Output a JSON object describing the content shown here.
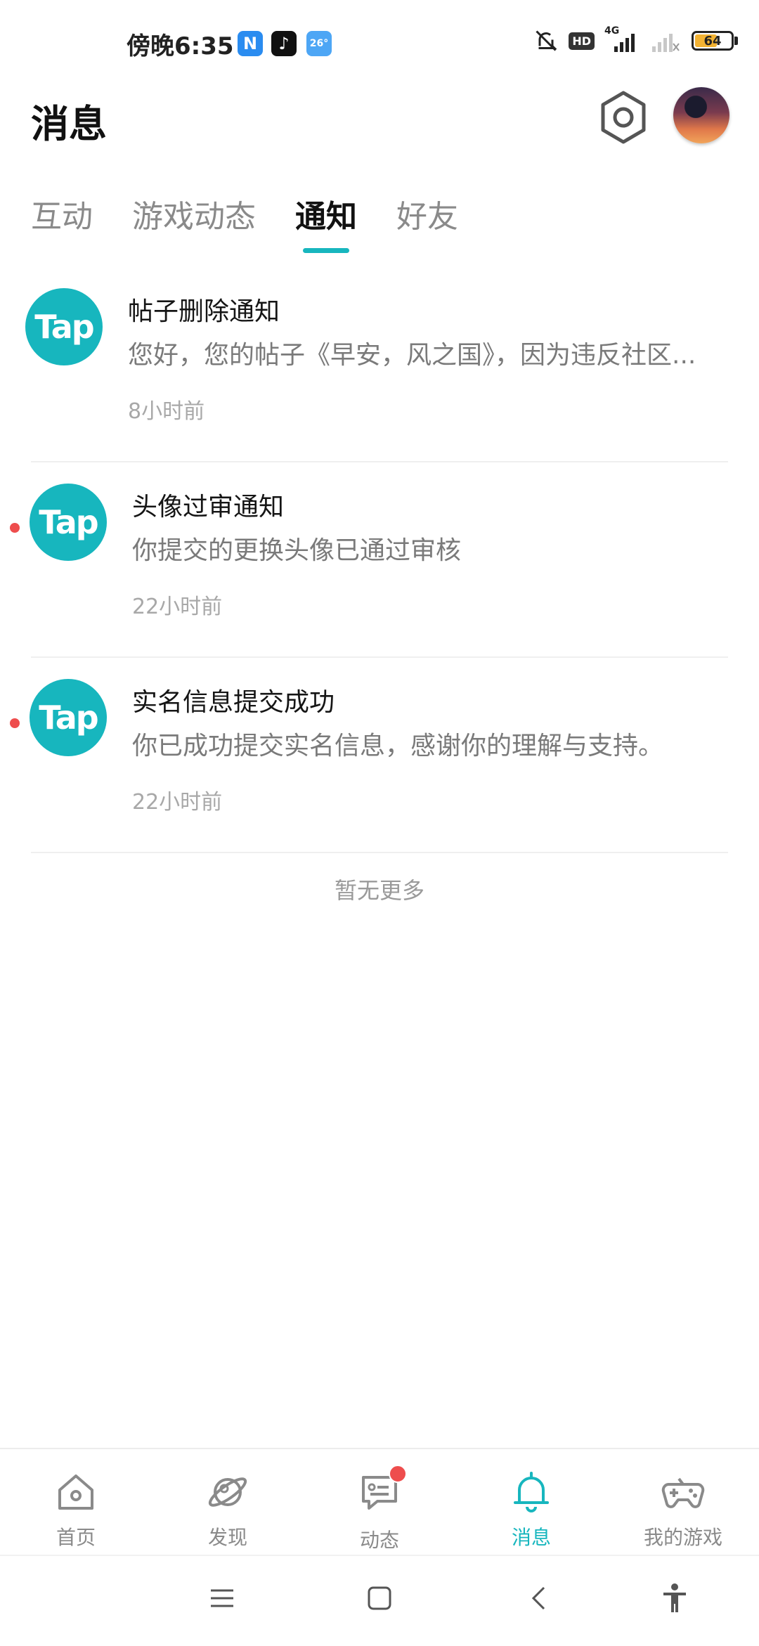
{
  "status_bar": {
    "time": "傍晚6:35",
    "app_icons": [
      {
        "name": "n-app-icon",
        "glyph": "N",
        "color": "#2a8cf0"
      },
      {
        "name": "tiktok-icon",
        "glyph": "♪",
        "color": "#111111"
      },
      {
        "name": "weather-icon",
        "glyph": "26°",
        "color": "#4da6f5"
      }
    ],
    "hd": "HD",
    "network": "4G",
    "battery": "64",
    "battery_level": 0.64
  },
  "header": {
    "title": "消息",
    "settings_icon": "settings-icon",
    "avatar": "avatar"
  },
  "tabs": [
    {
      "label": "互动",
      "active": false
    },
    {
      "label": "游戏动态",
      "active": false
    },
    {
      "label": "通知",
      "active": true
    },
    {
      "label": "好友",
      "active": false
    }
  ],
  "notifications": [
    {
      "logo": "Tap",
      "title": "帖子删除通知",
      "body": "您好，您的帖子《早安，风之国》，因为违反社区...",
      "time": "8小时前",
      "unread": false
    },
    {
      "logo": "Tap",
      "title": "头像过审通知",
      "body": "你提交的更换头像已通过审核",
      "time": "22小时前",
      "unread": true
    },
    {
      "logo": "Tap",
      "title": "实名信息提交成功",
      "body": "你已成功提交实名信息，感谢你的理解与支持。",
      "time": "22小时前",
      "unread": true
    }
  ],
  "no_more": "暂无更多",
  "bottom_nav": [
    {
      "label": "首页",
      "icon": "home-icon",
      "active": false,
      "badge": false
    },
    {
      "label": "发现",
      "icon": "planet-icon",
      "active": false,
      "badge": false
    },
    {
      "label": "动态",
      "icon": "chat-icon",
      "active": false,
      "badge": true
    },
    {
      "label": "消息",
      "icon": "bell-icon",
      "active": true,
      "badge": false
    },
    {
      "label": "我的游戏",
      "icon": "gamepad-icon",
      "active": false,
      "badge": false
    }
  ],
  "colors": {
    "accent": "#17b6be",
    "unread": "#ee4d4d"
  }
}
